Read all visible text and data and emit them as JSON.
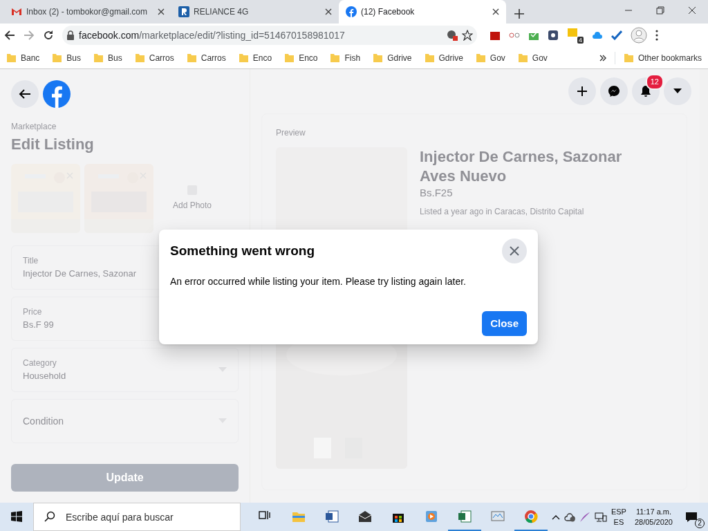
{
  "browser": {
    "tabs": [
      {
        "title": "Inbox (2) - tombokor@gmail.com",
        "kind": "gmail",
        "selected": false
      },
      {
        "title": "RELIANCE 4G",
        "kind": "reliance",
        "selected": false
      },
      {
        "title": "(12) Facebook",
        "kind": "facebook",
        "selected": true
      }
    ],
    "url_host": "facebook.com",
    "url_path": "/marketplace/edit/?listing_id=514670158981017",
    "extension_badge": "4",
    "bookmarks": [
      "Banc",
      "Bus",
      "Bus",
      "Carros",
      "Carros",
      "Enco",
      "Enco",
      "Fish",
      "Gdrive",
      "Gdrive",
      "Gov",
      "Gov"
    ],
    "other_bookmarks": "Other bookmarks"
  },
  "facebook": {
    "notification_count": "12"
  },
  "listing": {
    "breadcrumb": "Marketplace",
    "heading": "Edit Listing",
    "add_photo": "Add Photo",
    "fields": [
      {
        "label": "Title",
        "value": "Injector De Carnes, Sazonar",
        "kind": "text"
      },
      {
        "label": "Price",
        "value": "Bs.F 99",
        "kind": "text"
      },
      {
        "label": "Category",
        "value": "Household",
        "kind": "select"
      },
      {
        "label": "Condition",
        "kind": "select"
      }
    ],
    "update_button": "Update"
  },
  "preview": {
    "heading": "Preview",
    "title": "Injector De Carnes, Sazonar Aves Nuevo",
    "price": "Bs.F25",
    "meta": "Listed a year ago in Caracas, Distrito Capital"
  },
  "dialog": {
    "title": "Something went wrong",
    "message": "An error occurred while listing your item. Please try listing again later.",
    "button": "Close"
  },
  "taskbar": {
    "search_placeholder": "Escribe aquí para buscar",
    "apps": [
      {
        "kind": "taskview",
        "running": false
      },
      {
        "kind": "explorer",
        "running": false
      },
      {
        "kind": "word",
        "running": false
      },
      {
        "kind": "mail",
        "running": false
      },
      {
        "kind": "store",
        "running": false
      },
      {
        "kind": "media",
        "running": false
      },
      {
        "kind": "excel",
        "running": true
      },
      {
        "kind": "monitor",
        "running": false
      },
      {
        "kind": "chrome",
        "running": true
      }
    ],
    "lang_top": "ESP",
    "lang_bottom": "ES",
    "time": "11:17 a.m.",
    "date": "28/05/2020",
    "notifications": "2"
  }
}
